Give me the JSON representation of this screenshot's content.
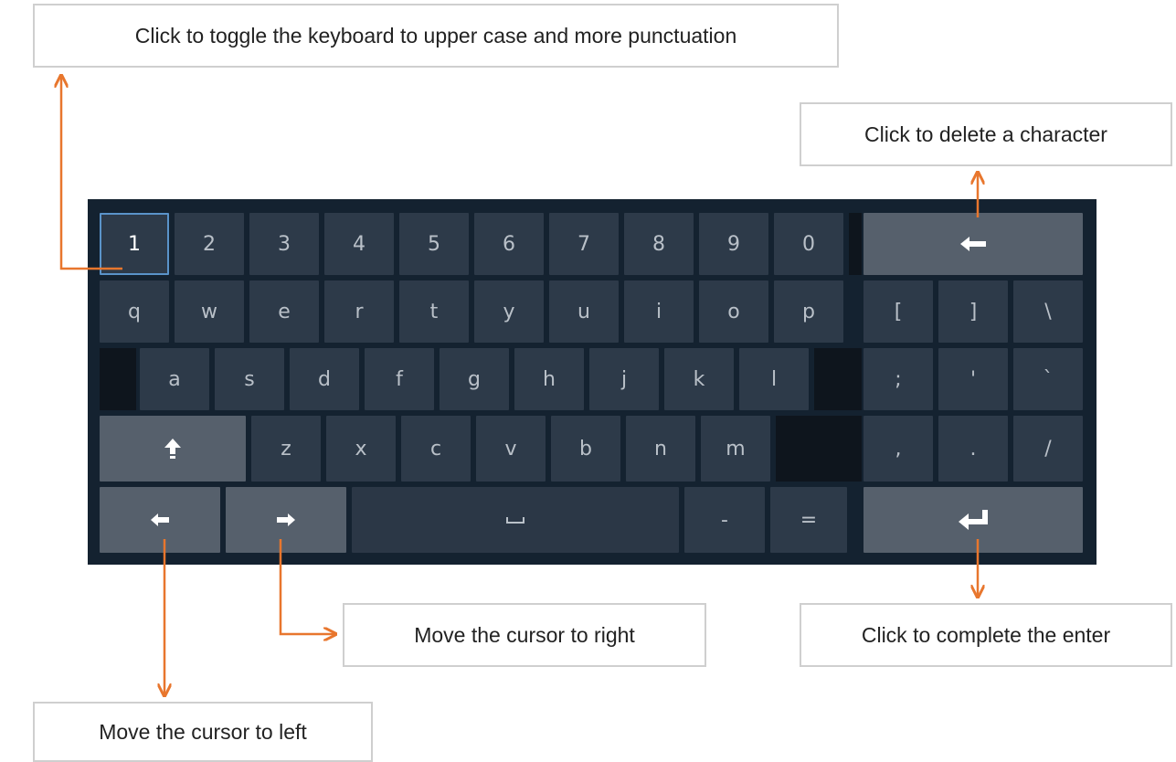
{
  "callouts": {
    "shift": "Click to toggle the keyboard to upper case and more punctuation",
    "delete": "Click to delete a character",
    "right": "Move the cursor to right",
    "enter": "Click to complete the enter",
    "left": "Move the cursor to left"
  },
  "keys": {
    "numbers": [
      "1",
      "2",
      "3",
      "4",
      "5",
      "6",
      "7",
      "8",
      "9",
      "0"
    ],
    "row_q": [
      "q",
      "w",
      "e",
      "r",
      "t",
      "y",
      "u",
      "i",
      "o",
      "p"
    ],
    "row_a": [
      "a",
      "s",
      "d",
      "f",
      "g",
      "h",
      "j",
      "k",
      "l"
    ],
    "row_z": [
      "z",
      "x",
      "c",
      "v",
      "b",
      "n",
      "m"
    ],
    "minus": "-",
    "equals": "=",
    "punct_row1": [
      "[",
      "]",
      "\\"
    ],
    "punct_row2": [
      ";",
      "'",
      "`"
    ],
    "punct_row3": [
      ",",
      ".",
      "/"
    ]
  },
  "icons": {
    "shift": "shift-arrow-up-icon",
    "backspace": "backspace-arrow-left-icon",
    "enter": "enter-return-icon",
    "cursor_left": "cursor-left-arrow-icon",
    "cursor_right": "cursor-right-arrow-icon",
    "space": "space-bar-icon"
  },
  "colors": {
    "keyboard_bg": "#142230",
    "key_bg": "#2d3a49",
    "key_light_bg": "#56606c",
    "selected_border": "#5a93c9",
    "arrow": "#e8762d"
  }
}
